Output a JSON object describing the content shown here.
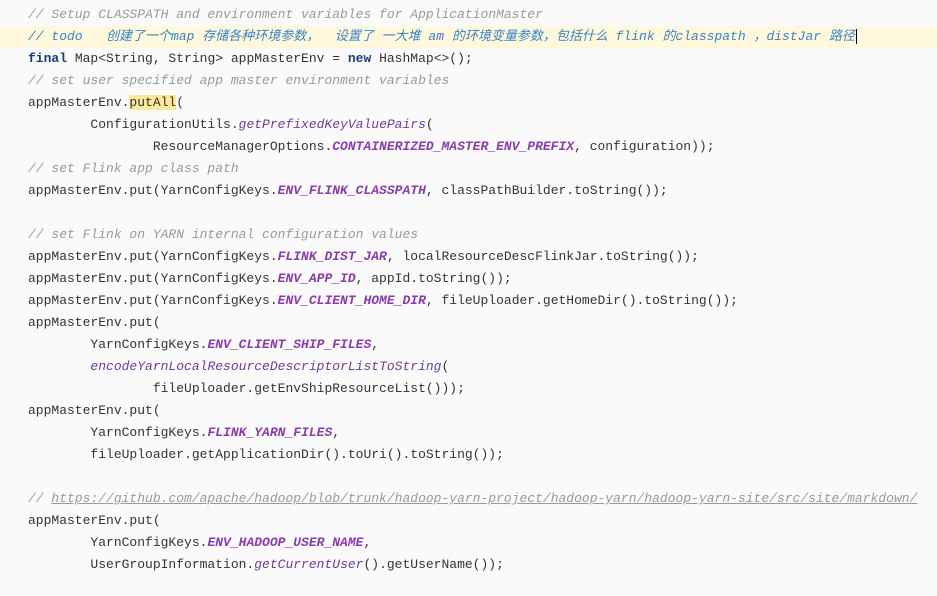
{
  "code": {
    "l1": "// Setup CLASSPATH and environment variables for ApplicationMaster",
    "l2_prefix": "// ",
    "l2_todo": "todo   创建了一个map 存储各种环境参数，  设置了 一大堆 am 的环境变量参数，包括什么 flink 的classpath ，distJar 路径",
    "l3_final": "final",
    "l3_a": " Map<String, String> appMasterEnv = ",
    "l3_new": "new",
    "l3_b": " HashMap<>();",
    "l4": "// set user specified app master environment variables",
    "l5_a": "appMasterEnv.",
    "l5_putall": "putAll",
    "l5_b": "(",
    "l6_a": "        ConfigurationUtils.",
    "l6_m": "getPrefixedKeyValuePairs",
    "l6_b": "(",
    "l7_a": "                ResourceManagerOptions.",
    "l7_c": "CONTAINERIZED_MASTER_ENV_PREFIX",
    "l7_b": ", configuration));",
    "l8": "// set Flink app class path",
    "l9_a": "appMasterEnv.put(YarnConfigKeys.",
    "l9_c": "ENV_FLINK_CLASSPATH",
    "l9_b": ", classPathBuilder.toString());",
    "l10": "",
    "l11": "// set Flink on YARN internal configuration values",
    "l12_a": "appMasterEnv.put(YarnConfigKeys.",
    "l12_c": "FLINK_DIST_JAR",
    "l12_b": ", localResourceDescFlinkJar.toString());",
    "l13_a": "appMasterEnv.put(YarnConfigKeys.",
    "l13_c": "ENV_APP_ID",
    "l13_b": ", appId.toString());",
    "l14_a": "appMasterEnv.put(YarnConfigKeys.",
    "l14_c": "ENV_CLIENT_HOME_DIR",
    "l14_b": ", fileUploader.getHomeDir().toString());",
    "l15": "appMasterEnv.put(",
    "l16_a": "        YarnConfigKeys.",
    "l16_c": "ENV_CLIENT_SHIP_FILES",
    "l16_b": ",",
    "l17_a": "        ",
    "l17_m": "encodeYarnLocalResourceDescriptorListToString",
    "l17_b": "(",
    "l18": "                fileUploader.getEnvShipResourceList()));",
    "l19": "appMasterEnv.put(",
    "l20_a": "        YarnConfigKeys.",
    "l20_c": "FLINK_YARN_FILES",
    "l20_b": ",",
    "l21": "        fileUploader.getApplicationDir().toUri().toString());",
    "l22": "",
    "l23_a": "// ",
    "l23_b": "https://github.com/apache/hadoop/blob/trunk/hadoop-yarn-project/hadoop-yarn/hadoop-yarn-site/src/site/markdown/",
    "l24": "appMasterEnv.put(",
    "l25_a": "        YarnConfigKeys.",
    "l25_c": "ENV_HADOOP_USER_NAME",
    "l25_b": ",",
    "l26_a": "        UserGroupInformation.",
    "l26_m": "getCurrentUser",
    "l26_b": "().getUserName());"
  }
}
